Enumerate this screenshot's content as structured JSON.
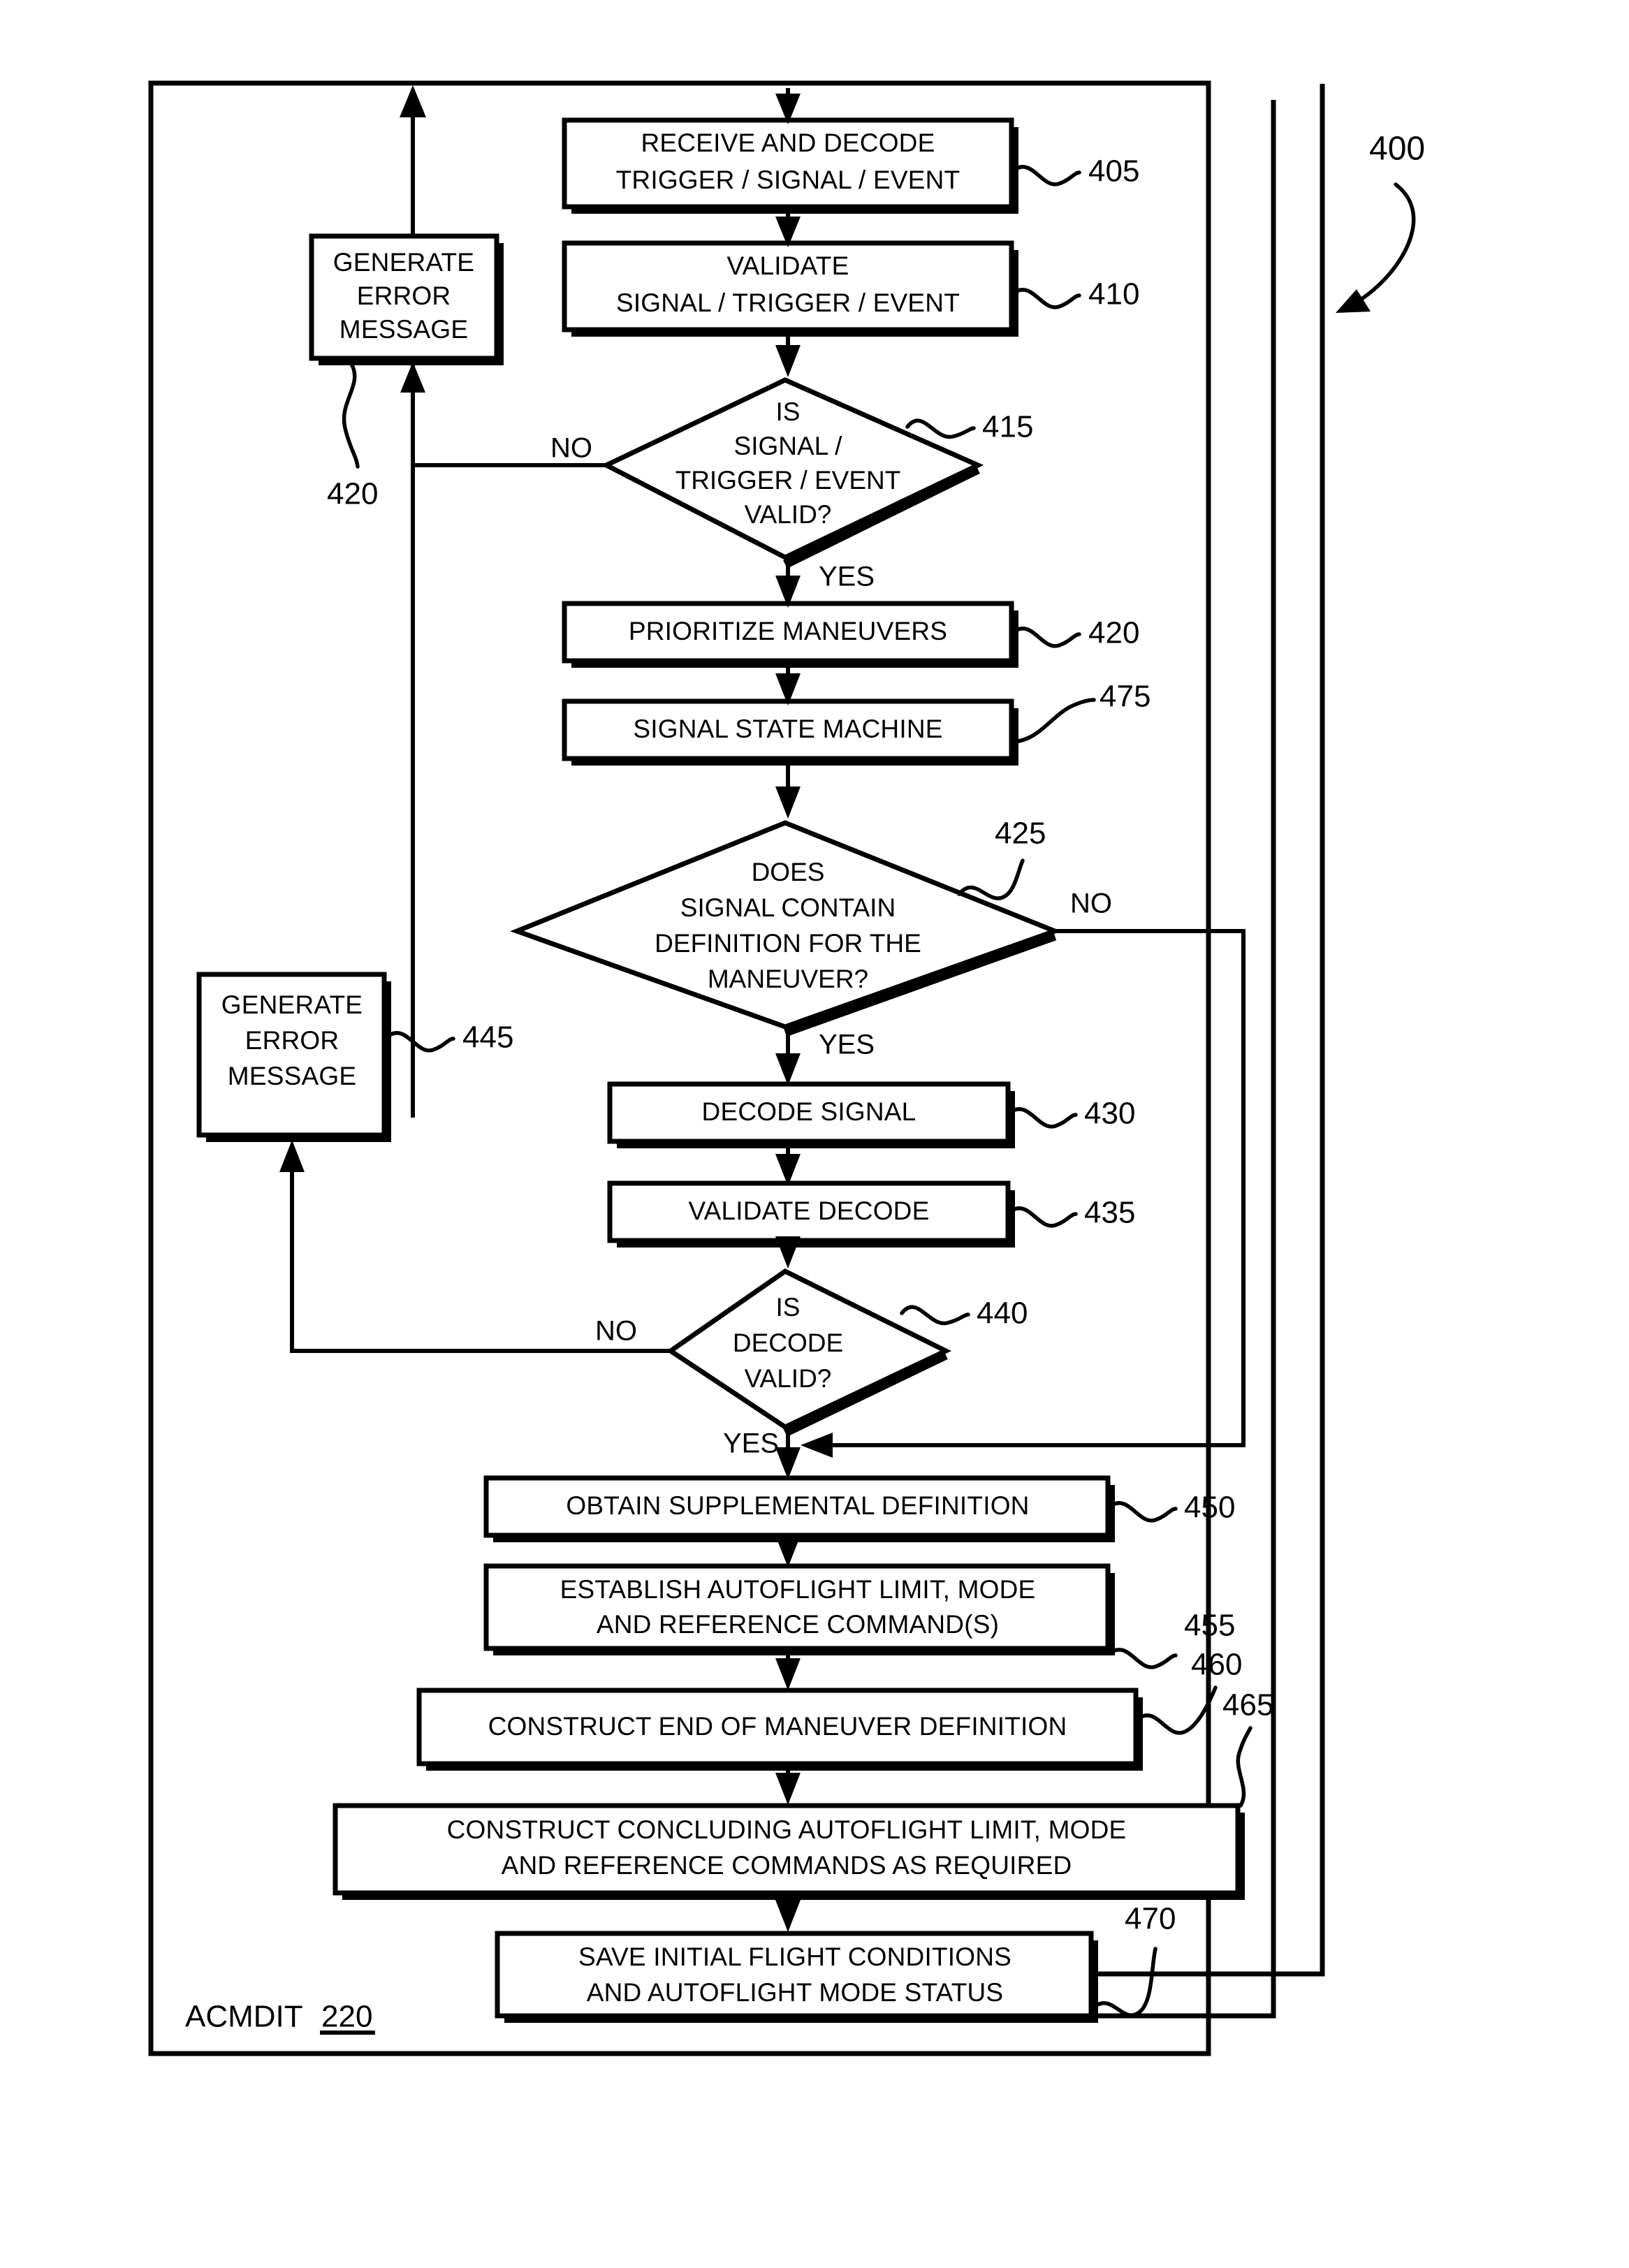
{
  "figure": {
    "number": "400",
    "caption_label": "ACMDIT",
    "caption_ref": "220"
  },
  "branch_labels": {
    "no": "NO",
    "yes": "YES"
  },
  "nodes": {
    "receive_decode": {
      "ref": "405",
      "line1": "RECEIVE AND DECODE",
      "line2": "TRIGGER / SIGNAL / EVENT"
    },
    "validate_signal": {
      "ref": "410",
      "line1": "VALIDATE",
      "line2": "SIGNAL / TRIGGER / EVENT"
    },
    "gen_error_1": {
      "ref": "420",
      "line1": "GENERATE",
      "line2": "ERROR",
      "line3": "MESSAGE"
    },
    "is_signal_valid": {
      "ref": "415",
      "line1": "IS",
      "line2": "SIGNAL /",
      "line3": "TRIGGER / EVENT",
      "line4": "VALID?"
    },
    "prioritize": {
      "ref": "420",
      "line1": "PRIORITIZE MANEUVERS"
    },
    "state_machine": {
      "ref": "475",
      "line1": "SIGNAL STATE MACHINE"
    },
    "does_contain_def": {
      "ref": "425",
      "line1": "DOES",
      "line2": "SIGNAL CONTAIN",
      "line3": "DEFINITION FOR THE",
      "line4": "MANEUVER?"
    },
    "gen_error_2": {
      "ref": "445",
      "line1": "GENERATE",
      "line2": "ERROR",
      "line3": "MESSAGE"
    },
    "decode_signal": {
      "ref": "430",
      "line1": "DECODE SIGNAL"
    },
    "validate_decode": {
      "ref": "435",
      "line1": "VALIDATE DECODE"
    },
    "is_decode_valid": {
      "ref": "440",
      "line1": "IS",
      "line2": "DECODE",
      "line3": "VALID?"
    },
    "obtain_supplemental": {
      "ref": "450",
      "line1": "OBTAIN SUPPLEMENTAL DEFINITION"
    },
    "establish_autoflight": {
      "ref": "455",
      "line1": "ESTABLISH AUTOFLIGHT LIMIT, MODE",
      "line2": "AND REFERENCE COMMAND(S)"
    },
    "construct_end": {
      "ref": "460",
      "line1": "CONSTRUCT END OF MANEUVER DEFINITION"
    },
    "construct_concluding": {
      "ref": "465",
      "line1": "CONSTRUCT CONCLUDING AUTOFLIGHT LIMIT, MODE",
      "line2": "AND REFERENCE COMMANDS AS REQUIRED"
    },
    "save_initial": {
      "ref": "470",
      "line1": "SAVE INITIAL FLIGHT CONDITIONS",
      "line2": "AND AUTOFLIGHT MODE STATUS"
    }
  },
  "colors": {
    "ink": "#000000",
    "paper": "#ffffff"
  }
}
